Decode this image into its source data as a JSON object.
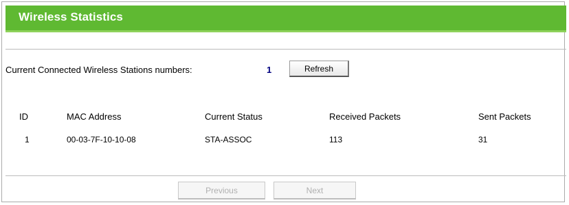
{
  "header": {
    "title": "Wireless Statistics"
  },
  "stations": {
    "label": "Current Connected Wireless Stations numbers:",
    "count": "1",
    "refresh_label": "Refresh"
  },
  "table": {
    "columns": [
      "ID",
      "MAC Address",
      "Current Status",
      "Received Packets",
      "Sent Packets"
    ],
    "rows": [
      [
        "1",
        "00-03-7F-10-10-08",
        "STA-ASSOC",
        "113",
        "31"
      ]
    ]
  },
  "nav": {
    "previous_label": "Previous",
    "next_label": "Next"
  },
  "colors": {
    "header_bg": "#5fb932",
    "header_text": "#ffffff",
    "count_text": "#000080"
  }
}
